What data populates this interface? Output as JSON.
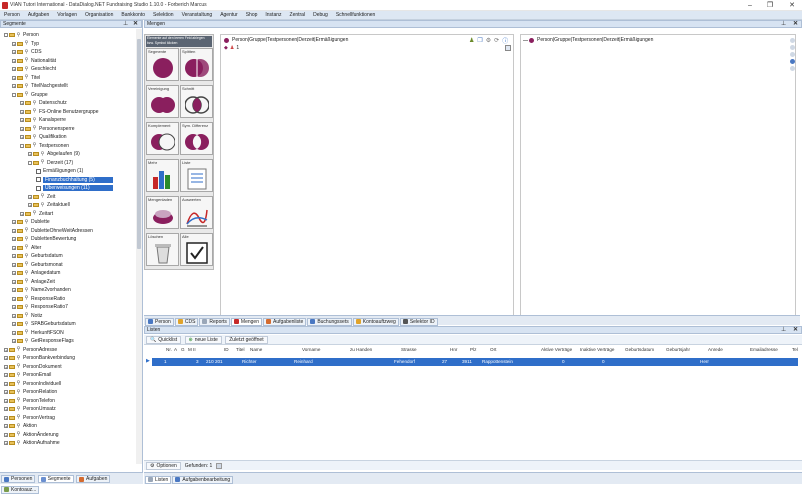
{
  "window": {
    "title": "VIAN Tutori International - DataDialog.NET Fundraising Studio 1.10.0 - Forberich Marcus"
  },
  "menu": [
    "Person",
    "Aufgaben",
    "Vorlagen",
    "Organisation",
    "Bankkonto",
    "Selektion",
    "Veranstaltung",
    "Agentur",
    "Shop",
    "Instanz",
    "Zentral",
    "Debug",
    "Schnellfunktionen"
  ],
  "left_panel": {
    "title": "Segmente",
    "tree": [
      {
        "label": "Person",
        "level": 0,
        "exp": "-"
      },
      {
        "label": "Typ",
        "level": 1,
        "exp": "+"
      },
      {
        "label": "CDS",
        "level": 1,
        "exp": "+"
      },
      {
        "label": "Nationalität",
        "level": 1,
        "exp": "+"
      },
      {
        "label": "Geschlecht",
        "level": 1,
        "exp": "+"
      },
      {
        "label": "Titel",
        "level": 1,
        "exp": "+"
      },
      {
        "label": "TitelNachgestellt",
        "level": 1,
        "exp": "+"
      },
      {
        "label": "Gruppe",
        "level": 1,
        "exp": "-"
      },
      {
        "label": "Datenschutz",
        "level": 2,
        "exp": "+"
      },
      {
        "label": "FS-Online Benutzergruppe",
        "level": 2,
        "exp": "+"
      },
      {
        "label": "Kanalsperre",
        "level": 2,
        "exp": "+"
      },
      {
        "label": "Personensperre",
        "level": 2,
        "exp": "+"
      },
      {
        "label": "Qualifikation",
        "level": 2,
        "exp": "+"
      },
      {
        "label": "Testpersonen",
        "level": 2,
        "exp": "-"
      },
      {
        "label": "Abgelaufen (9)",
        "level": 3,
        "exp": "+"
      },
      {
        "label": "Derzeit (17)",
        "level": 3,
        "exp": "-"
      },
      {
        "label": "Ermäßigungen (1)",
        "level": 4,
        "exp": "",
        "check": true
      },
      {
        "label": "Finanzbuchhaltung (5)",
        "level": 4,
        "exp": "",
        "check": true,
        "selected": true
      },
      {
        "label": "Überweisungen (11)",
        "level": 4,
        "exp": "",
        "check": true,
        "selected": true
      },
      {
        "label": "Zeit",
        "level": 3,
        "exp": "+"
      },
      {
        "label": "Zeitaktuell",
        "level": 3,
        "exp": "+"
      },
      {
        "label": "Zeitart",
        "level": 2,
        "exp": "+"
      },
      {
        "label": "Dublette",
        "level": 1,
        "exp": "+"
      },
      {
        "label": "DubletteOhneWeitAdressen",
        "level": 1,
        "exp": "+"
      },
      {
        "label": "DublettenBewertung",
        "level": 1,
        "exp": "+"
      },
      {
        "label": "Alter",
        "level": 1,
        "exp": "+"
      },
      {
        "label": "Geburtsdatum",
        "level": 1,
        "exp": "+"
      },
      {
        "label": "Geburtsmonat",
        "level": 1,
        "exp": "+"
      },
      {
        "label": "Anlagedatum",
        "level": 1,
        "exp": "+"
      },
      {
        "label": "AnlageZeit",
        "level": 1,
        "exp": "+"
      },
      {
        "label": "Name2vorhanden",
        "level": 1,
        "exp": "+"
      },
      {
        "label": "ResponseRatio",
        "level": 1,
        "exp": "+"
      },
      {
        "label": "ResponseRatio7",
        "level": 1,
        "exp": "+"
      },
      {
        "label": "Notiz",
        "level": 1,
        "exp": "+"
      },
      {
        "label": "SPABGeburtsdatum",
        "level": 1,
        "exp": "+"
      },
      {
        "label": "HerkunftFSON",
        "level": 1,
        "exp": "+"
      },
      {
        "label": "GetResponseFlags",
        "level": 1,
        "exp": "+"
      },
      {
        "label": "PersonAdresse",
        "level": 0,
        "exp": "+"
      },
      {
        "label": "PersonBankverbindung",
        "level": 0,
        "exp": "+"
      },
      {
        "label": "PersonDokument",
        "level": 0,
        "exp": "+"
      },
      {
        "label": "PersonEmail",
        "level": 0,
        "exp": "+"
      },
      {
        "label": "PersonIndividuell",
        "level": 0,
        "exp": "+"
      },
      {
        "label": "PersonRelation",
        "level": 0,
        "exp": "+"
      },
      {
        "label": "PersonTelefon",
        "level": 0,
        "exp": "+"
      },
      {
        "label": "PersonUmsatz",
        "level": 0,
        "exp": "+"
      },
      {
        "label": "PersonVertrag",
        "level": 0,
        "exp": "+"
      },
      {
        "label": "Aktion",
        "level": 0,
        "exp": "+"
      },
      {
        "label": "AktionÄnderung",
        "level": 0,
        "exp": "+"
      },
      {
        "label": "AktionAufnahme",
        "level": 0,
        "exp": "+"
      }
    ],
    "tabs": [
      "Personen",
      "Segmente",
      "Aufgaben",
      "Kontoauz..."
    ]
  },
  "mengen": {
    "title": "Mengen",
    "palette_hint": "Elemente auf den leeren Feld ablegen bzw. Symbol klicken",
    "tiles": [
      "Segmente",
      "Splitten",
      "Vereinigung",
      "Schnitt",
      "Komplement",
      "Sym. Differenz",
      "Mehr",
      "Liste",
      "Mengenladen",
      "Auswerten",
      "Löschen",
      "Alle"
    ],
    "left_path": "Person|Gruppe|Testpersonen|Derzeit|Ermäßigungen",
    "left_count": "1",
    "right_path": "Person|Gruppe|Testpersonen|Derzeit|Ermäßigungen",
    "tabs": [
      "Person",
      "CDS",
      "Reports",
      "Mengen",
      "Aufgabenliste",
      "Buchungssets",
      "Kontoauftzweg",
      "Selektor ID"
    ]
  },
  "listen": {
    "title": "Listen",
    "toolbar": [
      "Quicklist",
      "neue Liste",
      "Zuletzt geöffnet"
    ],
    "columns": [
      "Nr.",
      "A",
      "G",
      "M II",
      "ID",
      "Titel",
      "Name",
      "Vorname",
      "zu Handen",
      "Strasse",
      "Hnr",
      "Plz",
      "Ort",
      "Aktive Verträge",
      "Inaktive Verträge",
      "Geburtsdatum",
      "Geburtsjahr",
      "Anrede",
      "Emailadresse",
      "Tel"
    ],
    "row": {
      "nr": "1",
      "mi": "3",
      "id": "210 201",
      "name": "Richter",
      "vorname": "Reinhard",
      "strasse": "Fehendorf",
      "hnr": "27",
      "plz": "3911",
      "ort": "Rappottenstein",
      "aktiv": "0",
      "inaktiv": "0",
      "anrede": "Herr"
    },
    "footer_options": "Optionen",
    "footer_found": "Gefunden: 1",
    "bottom_tabs": [
      "Listen",
      "Aufgabenbearbeitung"
    ]
  },
  "colors": {
    "accent": "#2f6ec9",
    "panel_header": "#d7e3f2",
    "menubar": "#dde7f3",
    "set_purple": "#8a1f5e"
  }
}
